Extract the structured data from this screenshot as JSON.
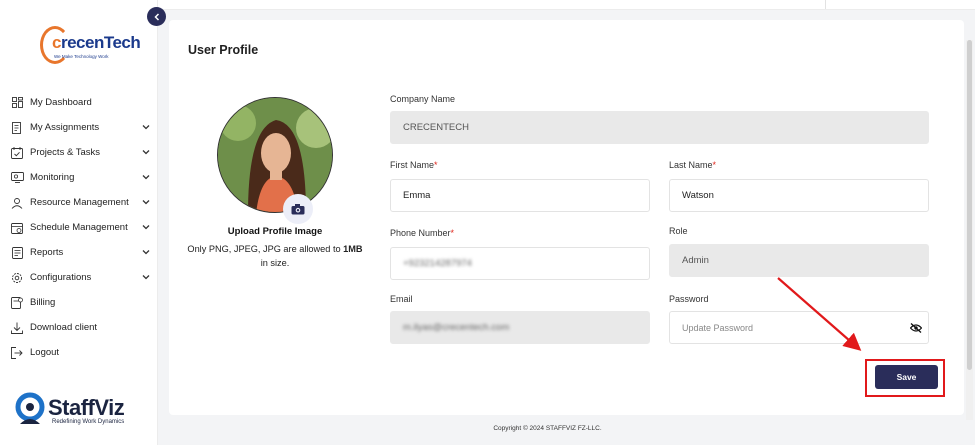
{
  "brand": {
    "company_logo_text_prefix": "c",
    "company_logo_text": "recenTech",
    "company_logo_tagline": "We Make Technology Work",
    "product_logo_text": "StaffViz",
    "product_logo_tagline": "Redefining Work Dynamics"
  },
  "sidebar": {
    "items": [
      {
        "label": "My Dashboard",
        "icon": "dashboard-icon",
        "expandable": false
      },
      {
        "label": "My Assignments",
        "icon": "assignments-icon",
        "expandable": true
      },
      {
        "label": "Projects & Tasks",
        "icon": "calendar-check-icon",
        "expandable": true
      },
      {
        "label": "Monitoring",
        "icon": "monitor-icon",
        "expandable": true
      },
      {
        "label": "Resource Management",
        "icon": "resource-icon",
        "expandable": true
      },
      {
        "label": "Schedule Management",
        "icon": "schedule-icon",
        "expandable": true
      },
      {
        "label": "Reports",
        "icon": "report-icon",
        "expandable": true
      },
      {
        "label": "Configurations",
        "icon": "settings-icon",
        "expandable": true
      },
      {
        "label": "Billing",
        "icon": "billing-icon",
        "expandable": false
      },
      {
        "label": "Download client",
        "icon": "download-icon",
        "expandable": false
      },
      {
        "label": "Logout",
        "icon": "logout-icon",
        "expandable": false
      }
    ]
  },
  "profile": {
    "title": "User Profile",
    "upload_title": "Upload Profile Image",
    "upload_note_prefix": "Only PNG, JPEG, JPG are allowed to ",
    "upload_note_size": "1MB",
    "upload_note_suffix": " in size."
  },
  "form": {
    "company_name": {
      "label": "Company Name",
      "value": "CRECENTECH"
    },
    "first_name": {
      "label": "First Name",
      "value": "Emma",
      "required": "*"
    },
    "last_name": {
      "label": "Last Name",
      "value": "Watson",
      "required": "*"
    },
    "phone_number": {
      "label": "Phone Number",
      "value": "+923214287974",
      "required": "*"
    },
    "role": {
      "label": "Role",
      "value": "Admin"
    },
    "email": {
      "label": "Email",
      "value": "m.ilyas@crecentech.com"
    },
    "password": {
      "label": "Password",
      "placeholder": "Update Password"
    },
    "save_label": "Save"
  },
  "footer": {
    "copyright": "Copyright © 2024 STAFFVIZ FZ-LLC."
  },
  "colors": {
    "primary": "#2a2d5a",
    "required": "#e1251b",
    "annotation": "#e1191b",
    "disabled_field": "#e9e9e9"
  }
}
